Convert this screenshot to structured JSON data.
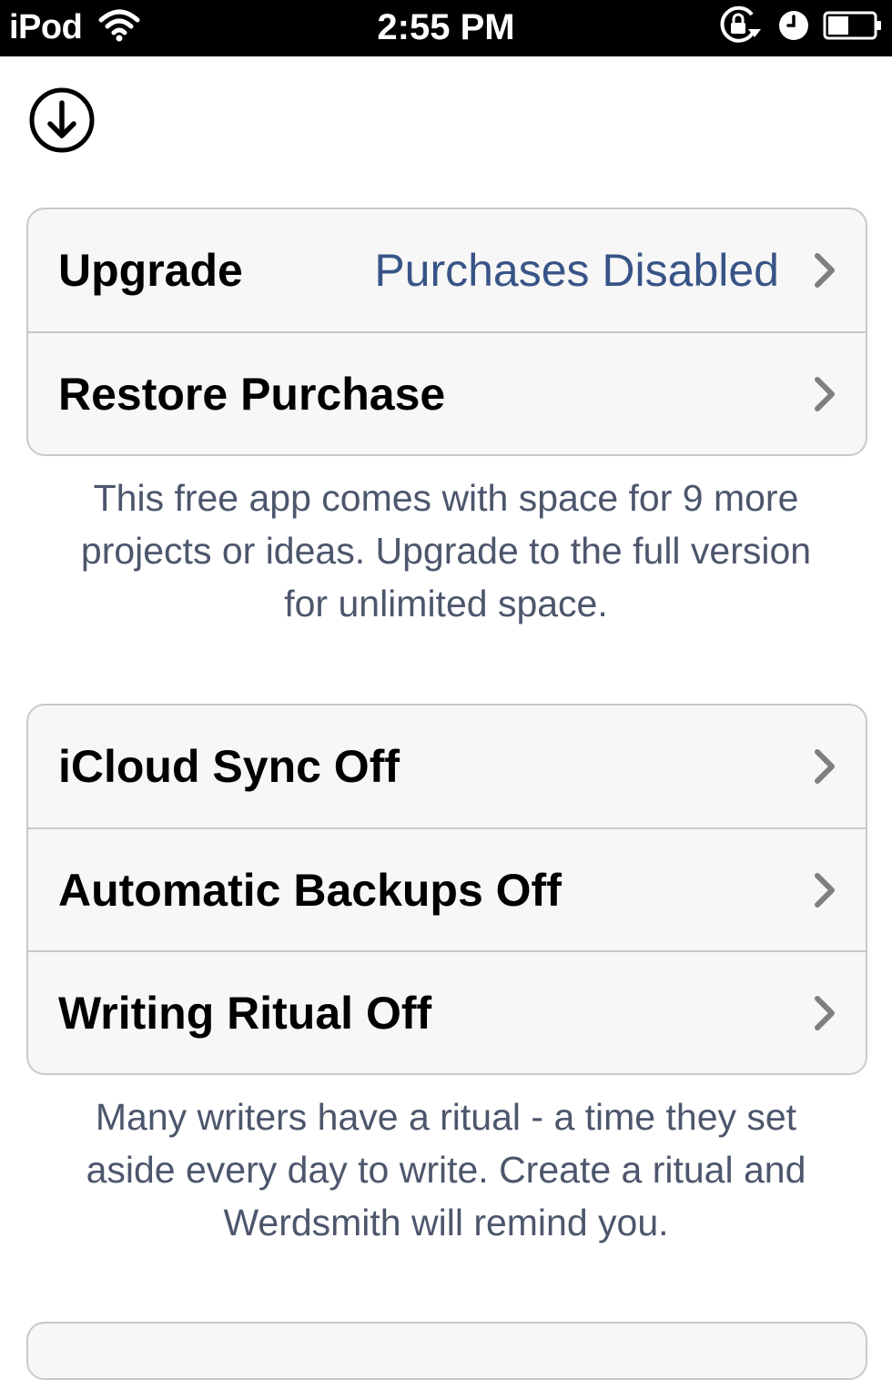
{
  "status_bar": {
    "carrier": "iPod",
    "time": "2:55 PM"
  },
  "purchase_group": {
    "upgrade_label": "Upgrade",
    "upgrade_value": "Purchases Disabled",
    "restore_label": "Restore Purchase",
    "footer": "This free app comes with space for 9 more projects or ideas. Upgrade to the full version for unlimited space."
  },
  "settings_group": {
    "icloud_label": "iCloud Sync Off",
    "backups_label": "Automatic Backups Off",
    "ritual_label": "Writing Ritual Off",
    "footer": "Many writers have a ritual -  a time they set aside every day to write. Create a ritual and Werdsmith will remind you."
  },
  "colors": {
    "value_text": "#385487",
    "footer_text": "#4c566c",
    "cell_background": "#f7f7f7",
    "separator": "#c8c8cc"
  }
}
